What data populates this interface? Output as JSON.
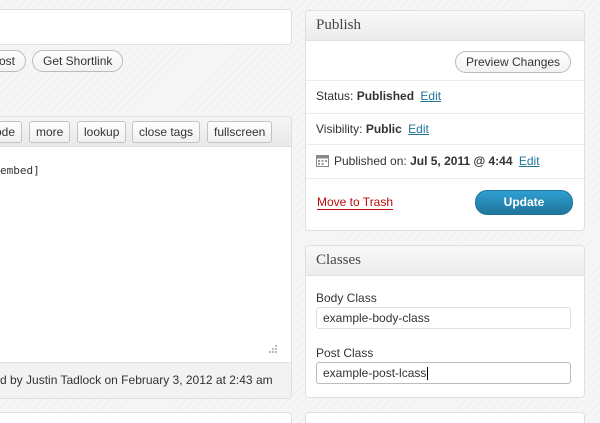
{
  "editor": {
    "buttons": {
      "preview_post": "ost",
      "get_shortlink": "Get Shortlink"
    },
    "quicktags": [
      "ode",
      "more",
      "lookup",
      "close tags",
      "fullscreen"
    ],
    "content": "embed]",
    "footer": "d by Justin Tadlock on February 3, 2012 at 2:43 am"
  },
  "publish": {
    "title": "Publish",
    "preview_changes": "Preview Changes",
    "status_label": "Status:",
    "status_value": "Published",
    "visibility_label": "Visibility:",
    "visibility_value": "Public",
    "published_label": "Published on:",
    "published_value": "Jul 5, 2011 @ 4:44",
    "edit": "Edit",
    "move_to_trash": "Move to Trash",
    "update": "Update"
  },
  "classes": {
    "title": "Classes",
    "body_class_label": "Body Class",
    "body_class_value": "example-body-class",
    "post_class_label": "Post Class",
    "post_class_value": "example-post-lcass"
  },
  "colors": {
    "link": "#21759b",
    "trash": "#bc0b0b",
    "primary_button": "#21759b"
  }
}
